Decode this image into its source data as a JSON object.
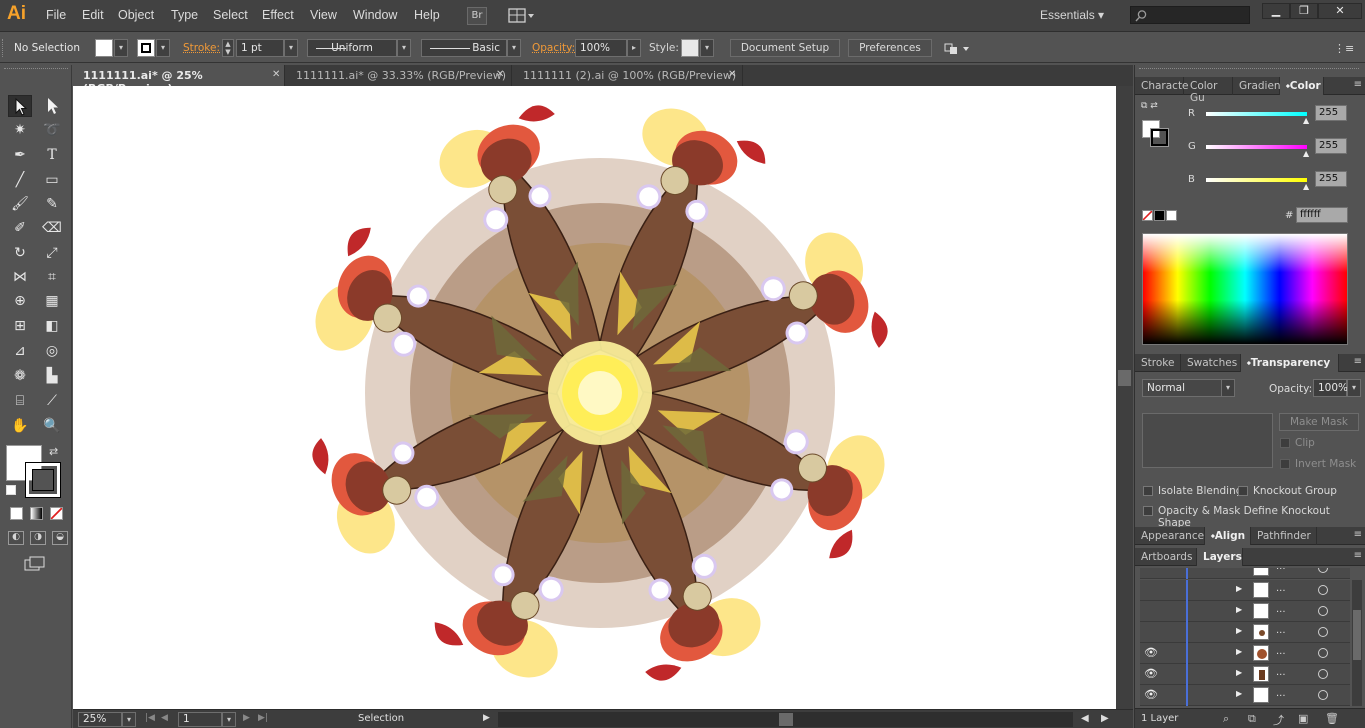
{
  "app": {
    "logo": "Ai",
    "menu": [
      "File",
      "Edit",
      "Object",
      "Type",
      "Select",
      "Effect",
      "View",
      "Window",
      "Help"
    ],
    "bridge_label": "Br",
    "workspace": "Essentials"
  },
  "controlbar": {
    "selection": "No Selection",
    "stroke_label": "Stroke:",
    "stroke_weight": "1 pt",
    "profile": "Uniform",
    "brush": "Basic",
    "opacity_label": "Opacity:",
    "opacity_value": "100%",
    "style_label": "Style:",
    "document_setup": "Document Setup",
    "preferences": "Preferences"
  },
  "tabs": [
    {
      "label": "1111111.ai* @ 25% (RGB/Preview)"
    },
    {
      "label": "1111111.ai* @ 33.33% (RGB/Preview)"
    },
    {
      "label": "1111111 (2).ai @ 100% (RGB/Preview)"
    }
  ],
  "statusbar": {
    "zoom": "25%",
    "artboard": "1",
    "tool": "Selection"
  },
  "color_panel": {
    "tabs": [
      "Characte",
      "Color Gu",
      "Gradient",
      "Color"
    ],
    "r_label": "R",
    "g_label": "G",
    "b_label": "B",
    "r_value": "255",
    "g_value": "255",
    "b_value": "255",
    "hex_label": "#",
    "hex_value": "ffffff",
    "r_color": "#00ffff",
    "g_color": "#ff00ff",
    "b_color": "#ffff00"
  },
  "transparency_panel": {
    "tabs": [
      "Stroke",
      "Swatches",
      "Transparency"
    ],
    "blend_mode": "Normal",
    "opacity_label": "Opacity:",
    "opacity_value": "100%",
    "make_mask": "Make Mask",
    "clip": "Clip",
    "invert_mask": "Invert Mask",
    "isolate_blending": "Isolate Blending",
    "knockout_group": "Knockout Group",
    "opacity_mask": "Opacity & Mask Define Knockout Shape"
  },
  "appearance_tabs": [
    "Appearance",
    "Align",
    "Pathfinder"
  ],
  "layers_panel": {
    "tabs": [
      "Artboards",
      "Layers"
    ],
    "rows": [
      {
        "name": "...",
        "visible": false
      },
      {
        "name": "...",
        "visible": false
      },
      {
        "name": "...",
        "visible": false
      },
      {
        "name": "...",
        "visible": false
      },
      {
        "name": "...",
        "visible": true
      },
      {
        "name": "...",
        "visible": true
      },
      {
        "name": "...",
        "visible": true
      }
    ],
    "footer": "1 Layer"
  }
}
